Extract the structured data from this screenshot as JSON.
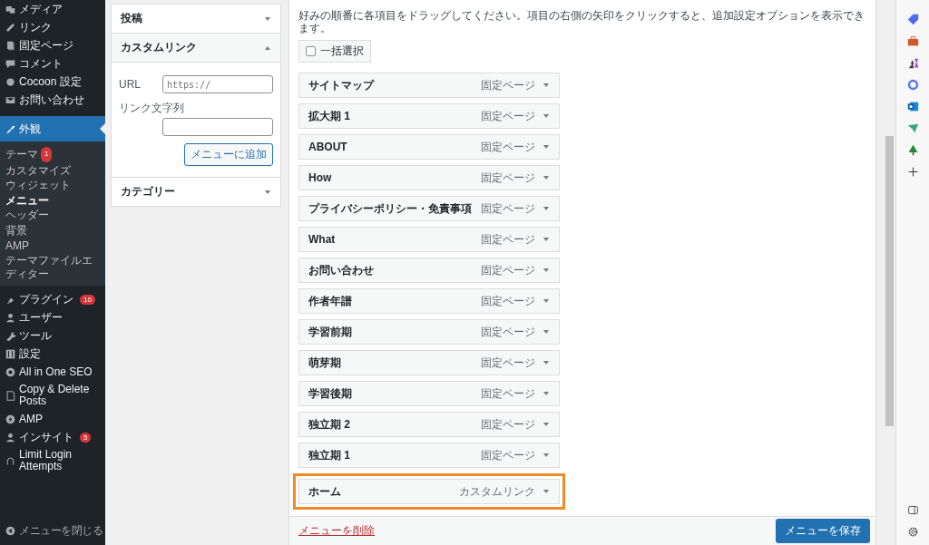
{
  "sidebar": {
    "items": [
      {
        "label": "メディア",
        "selected": false
      },
      {
        "label": "リンク",
        "selected": false
      },
      {
        "label": "固定ページ",
        "selected": false
      },
      {
        "label": "コメント",
        "selected": false
      },
      {
        "label": "Cocoon 設定",
        "selected": false
      },
      {
        "label": "お問い合わせ",
        "selected": false
      },
      {
        "label": "外観",
        "selected": true,
        "children": [
          {
            "label": "テーマ",
            "badge": "1",
            "selected": false
          },
          {
            "label": "カスタマイズ",
            "selected": false
          },
          {
            "label": "ウィジェット",
            "selected": false
          },
          {
            "label": "メニュー",
            "selected": true
          },
          {
            "label": "ヘッダー",
            "selected": false
          },
          {
            "label": "背景",
            "selected": false
          },
          {
            "label": "AMP",
            "selected": false
          },
          {
            "label": "テーマファイルエディター",
            "selected": false
          }
        ]
      },
      {
        "label": "プラグイン",
        "badge": "10",
        "selected": false
      },
      {
        "label": "ユーザー",
        "selected": false
      },
      {
        "label": "ツール",
        "selected": false
      },
      {
        "label": "設定",
        "selected": false
      },
      {
        "label": "All in One SEO",
        "selected": false
      },
      {
        "label": "Copy & Delete Posts",
        "selected": false
      },
      {
        "label": "AMP",
        "selected": false
      },
      {
        "label": "インサイト",
        "badge": "5",
        "selected": false
      },
      {
        "label": "Limit Login Attempts",
        "selected": false
      }
    ],
    "collapse": "メニューを閉じる"
  },
  "add_panel": {
    "sections": [
      {
        "title": "投稿",
        "expanded": false
      },
      {
        "title": "カスタムリンク",
        "expanded": true,
        "url_label": "URL",
        "url_placeholder": "https://",
        "text_label": "リンク文字列",
        "button": "メニューに追加"
      },
      {
        "title": "カテゴリー",
        "expanded": false
      }
    ]
  },
  "structure": {
    "instructions": "好みの順番に各項目をドラッグしてください。項目の右側の矢印をクリックすると、追加設定オプションを表示できます。",
    "bulk_select": {
      "label": "一括選択",
      "checked": false
    },
    "items": [
      {
        "title": "サイトマップ",
        "type": "固定ページ",
        "highlighted": false
      },
      {
        "title": "拡大期 1",
        "type": "固定ページ",
        "highlighted": false
      },
      {
        "title": "ABOUT",
        "type": "固定ページ",
        "highlighted": false
      },
      {
        "title": "How",
        "type": "固定ページ",
        "highlighted": false
      },
      {
        "title": "プライバシーポリシー・免責事項",
        "type": "固定ページ",
        "highlighted": false
      },
      {
        "title": "What",
        "type": "固定ページ",
        "highlighted": false
      },
      {
        "title": "お問い合わせ",
        "type": "固定ページ",
        "highlighted": false
      },
      {
        "title": "作者年譜",
        "type": "固定ページ",
        "highlighted": false
      },
      {
        "title": "学習前期",
        "type": "固定ページ",
        "highlighted": false
      },
      {
        "title": "萌芽期",
        "type": "固定ページ",
        "highlighted": false
      },
      {
        "title": "学習後期",
        "type": "固定ページ",
        "highlighted": false
      },
      {
        "title": "独立期 2",
        "type": "固定ページ",
        "highlighted": false
      },
      {
        "title": "独立期 1",
        "type": "固定ページ",
        "highlighted": false
      },
      {
        "title": "ホーム",
        "type": "カスタムリンク",
        "highlighted": true
      }
    ],
    "delete_link": "メニューを削除",
    "save_button": "メニューを保存"
  }
}
